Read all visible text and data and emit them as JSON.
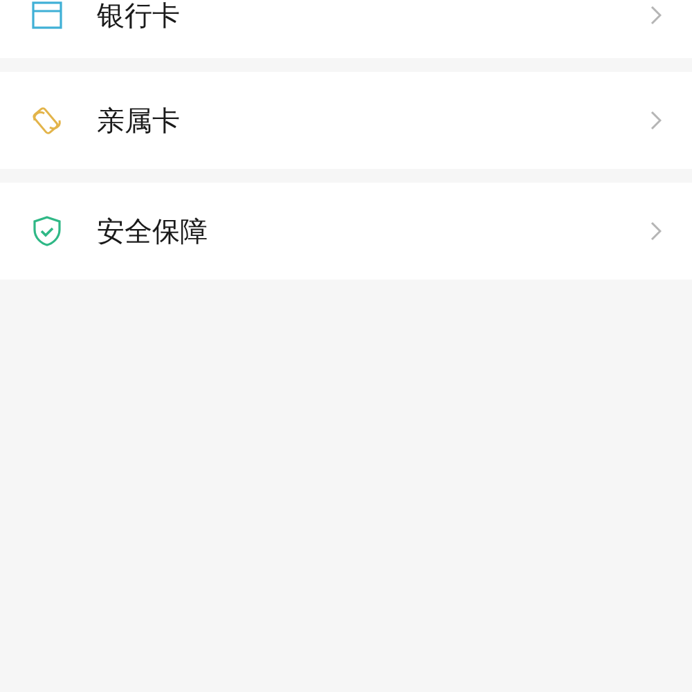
{
  "menu_items": [
    {
      "kind": "card",
      "label": "银行卡"
    },
    {
      "kind": "family",
      "label": "亲属卡"
    },
    {
      "kind": "shield",
      "label": "安全保障"
    }
  ]
}
